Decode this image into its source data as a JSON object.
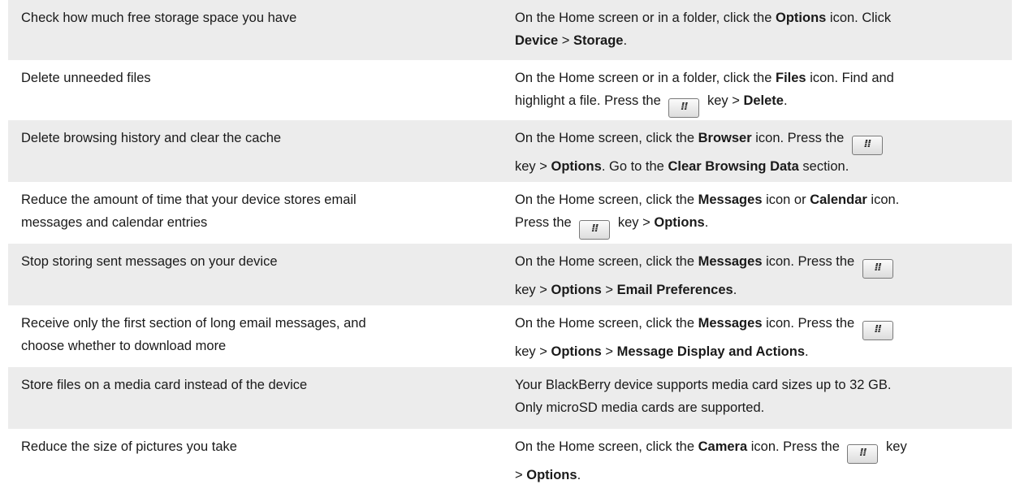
{
  "rows": [
    {
      "task": "Check how much free storage space you have",
      "how": {
        "l1": [
          [
            "On the Home screen or in a folder, click the ",
            false
          ],
          [
            "Options",
            true
          ],
          [
            " icon. Click",
            false
          ]
        ],
        "l2": [
          [
            "Device",
            true
          ],
          [
            " > ",
            false
          ],
          [
            "Storage",
            true
          ],
          [
            ".",
            false
          ]
        ]
      }
    },
    {
      "task": "Delete unneeded files",
      "how": {
        "l1": [
          [
            "On the Home screen or in a folder, click the ",
            false
          ],
          [
            "Files",
            true
          ],
          [
            " icon. Find and",
            false
          ]
        ],
        "l2": [
          [
            "highlight a file. Press the ",
            false
          ],
          [
            "#menu-key",
            false
          ],
          [
            " key > ",
            false
          ],
          [
            "Delete",
            true
          ],
          [
            ".",
            false
          ]
        ]
      }
    },
    {
      "task": "Delete browsing history and clear the cache",
      "how": {
        "l1": [
          [
            "On the Home screen, click the ",
            false
          ],
          [
            "Browser",
            true
          ],
          [
            " icon. Press the ",
            false
          ],
          [
            "#menu-key",
            false
          ]
        ],
        "l2": [
          [
            "key > ",
            false
          ],
          [
            "Options",
            true
          ],
          [
            ". Go to the ",
            false
          ],
          [
            "Clear Browsing Data",
            true
          ],
          [
            " section.",
            false
          ]
        ]
      }
    },
    {
      "task_l1": "Reduce the amount of time that your device stores email",
      "task_l2": "messages and calendar entries",
      "how": {
        "l1": [
          [
            "On the Home screen, click the ",
            false
          ],
          [
            "Messages",
            true
          ],
          [
            " icon or ",
            false
          ],
          [
            "Calendar",
            true
          ],
          [
            " icon.",
            false
          ]
        ],
        "l2": [
          [
            "Press the ",
            false
          ],
          [
            "#menu-key",
            false
          ],
          [
            " key > ",
            false
          ],
          [
            "Options",
            true
          ],
          [
            ".",
            false
          ]
        ]
      }
    },
    {
      "task": "Stop storing sent messages on your device",
      "how": {
        "l1": [
          [
            "On the Home screen, click the ",
            false
          ],
          [
            "Messages",
            true
          ],
          [
            " icon. Press the ",
            false
          ],
          [
            "#menu-key",
            false
          ]
        ],
        "l2": [
          [
            "key > ",
            false
          ],
          [
            "Options",
            true
          ],
          [
            " > ",
            false
          ],
          [
            "Email Preferences",
            true
          ],
          [
            ".",
            false
          ]
        ]
      }
    },
    {
      "task_l1": "Receive only the first section of long email messages, and",
      "task_l2": "choose whether to download more",
      "how": {
        "l1": [
          [
            "On the Home screen, click the ",
            false
          ],
          [
            "Messages",
            true
          ],
          [
            " icon. Press the ",
            false
          ],
          [
            "#menu-key",
            false
          ]
        ],
        "l2": [
          [
            "key > ",
            false
          ],
          [
            "Options",
            true
          ],
          [
            " > ",
            false
          ],
          [
            "Message Display and Actions",
            true
          ],
          [
            ".",
            false
          ]
        ]
      }
    },
    {
      "task": "Store files on a media card instead of the device",
      "how": {
        "l1": [
          [
            "Your BlackBerry device supports media card sizes up to 32 GB.",
            false
          ]
        ],
        "l2": [
          [
            "Only microSD media cards are supported.",
            false
          ]
        ]
      }
    },
    {
      "task": "Reduce the size of pictures you take",
      "how": {
        "l1": [
          [
            "On the Home screen, click the ",
            false
          ],
          [
            "Camera",
            true
          ],
          [
            " icon. Press the ",
            false
          ],
          [
            "#menu-key",
            false
          ],
          [
            " key",
            false
          ]
        ],
        "l2": [
          [
            "> ",
            false
          ],
          [
            "Options",
            true
          ],
          [
            ".",
            false
          ]
        ]
      }
    }
  ],
  "menu_key_glyph": "⁞⁞"
}
